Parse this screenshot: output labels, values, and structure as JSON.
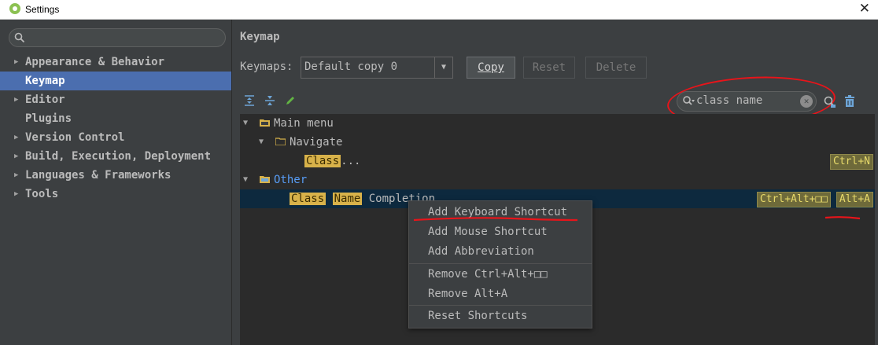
{
  "window": {
    "title": "Settings"
  },
  "sidebar": {
    "search_value": "",
    "items": [
      {
        "label": "Appearance & Behavior"
      },
      {
        "label": "Keymap"
      },
      {
        "label": "Editor"
      },
      {
        "label": "Plugins"
      },
      {
        "label": "Version Control"
      },
      {
        "label": "Build, Execution, Deployment"
      },
      {
        "label": "Languages & Frameworks"
      },
      {
        "label": "Tools"
      }
    ]
  },
  "main": {
    "header": "Keymap",
    "keymaps_label": "Keymaps:",
    "keymap_selected": "Default copy 0",
    "copy_label": "Copy",
    "reset_label": "Reset",
    "delete_label": "Delete",
    "filter_value": "class name"
  },
  "tree": {
    "main_menu": "Main menu",
    "navigate": "Navigate",
    "class_hl": "Class",
    "class_rest": "...",
    "class_shortcut": "Ctrl+N",
    "other": "Other",
    "completion_hl1": "Class",
    "completion_hl2": "Name",
    "completion_rest": "Completion",
    "completion_shortcut1": "Ctrl+Alt+□□",
    "completion_shortcut2": "Alt+A"
  },
  "context_menu": {
    "items": [
      "Add Keyboard Shortcut",
      "Add Mouse Shortcut",
      "Add Abbreviation",
      "Remove Ctrl+Alt+□□",
      "Remove Alt+A",
      "Reset Shortcuts"
    ]
  },
  "colors": {
    "selection": "#4b6eaf",
    "highlight": "#d8b24a",
    "annotation": "#e8141a",
    "link": "#589df6"
  }
}
